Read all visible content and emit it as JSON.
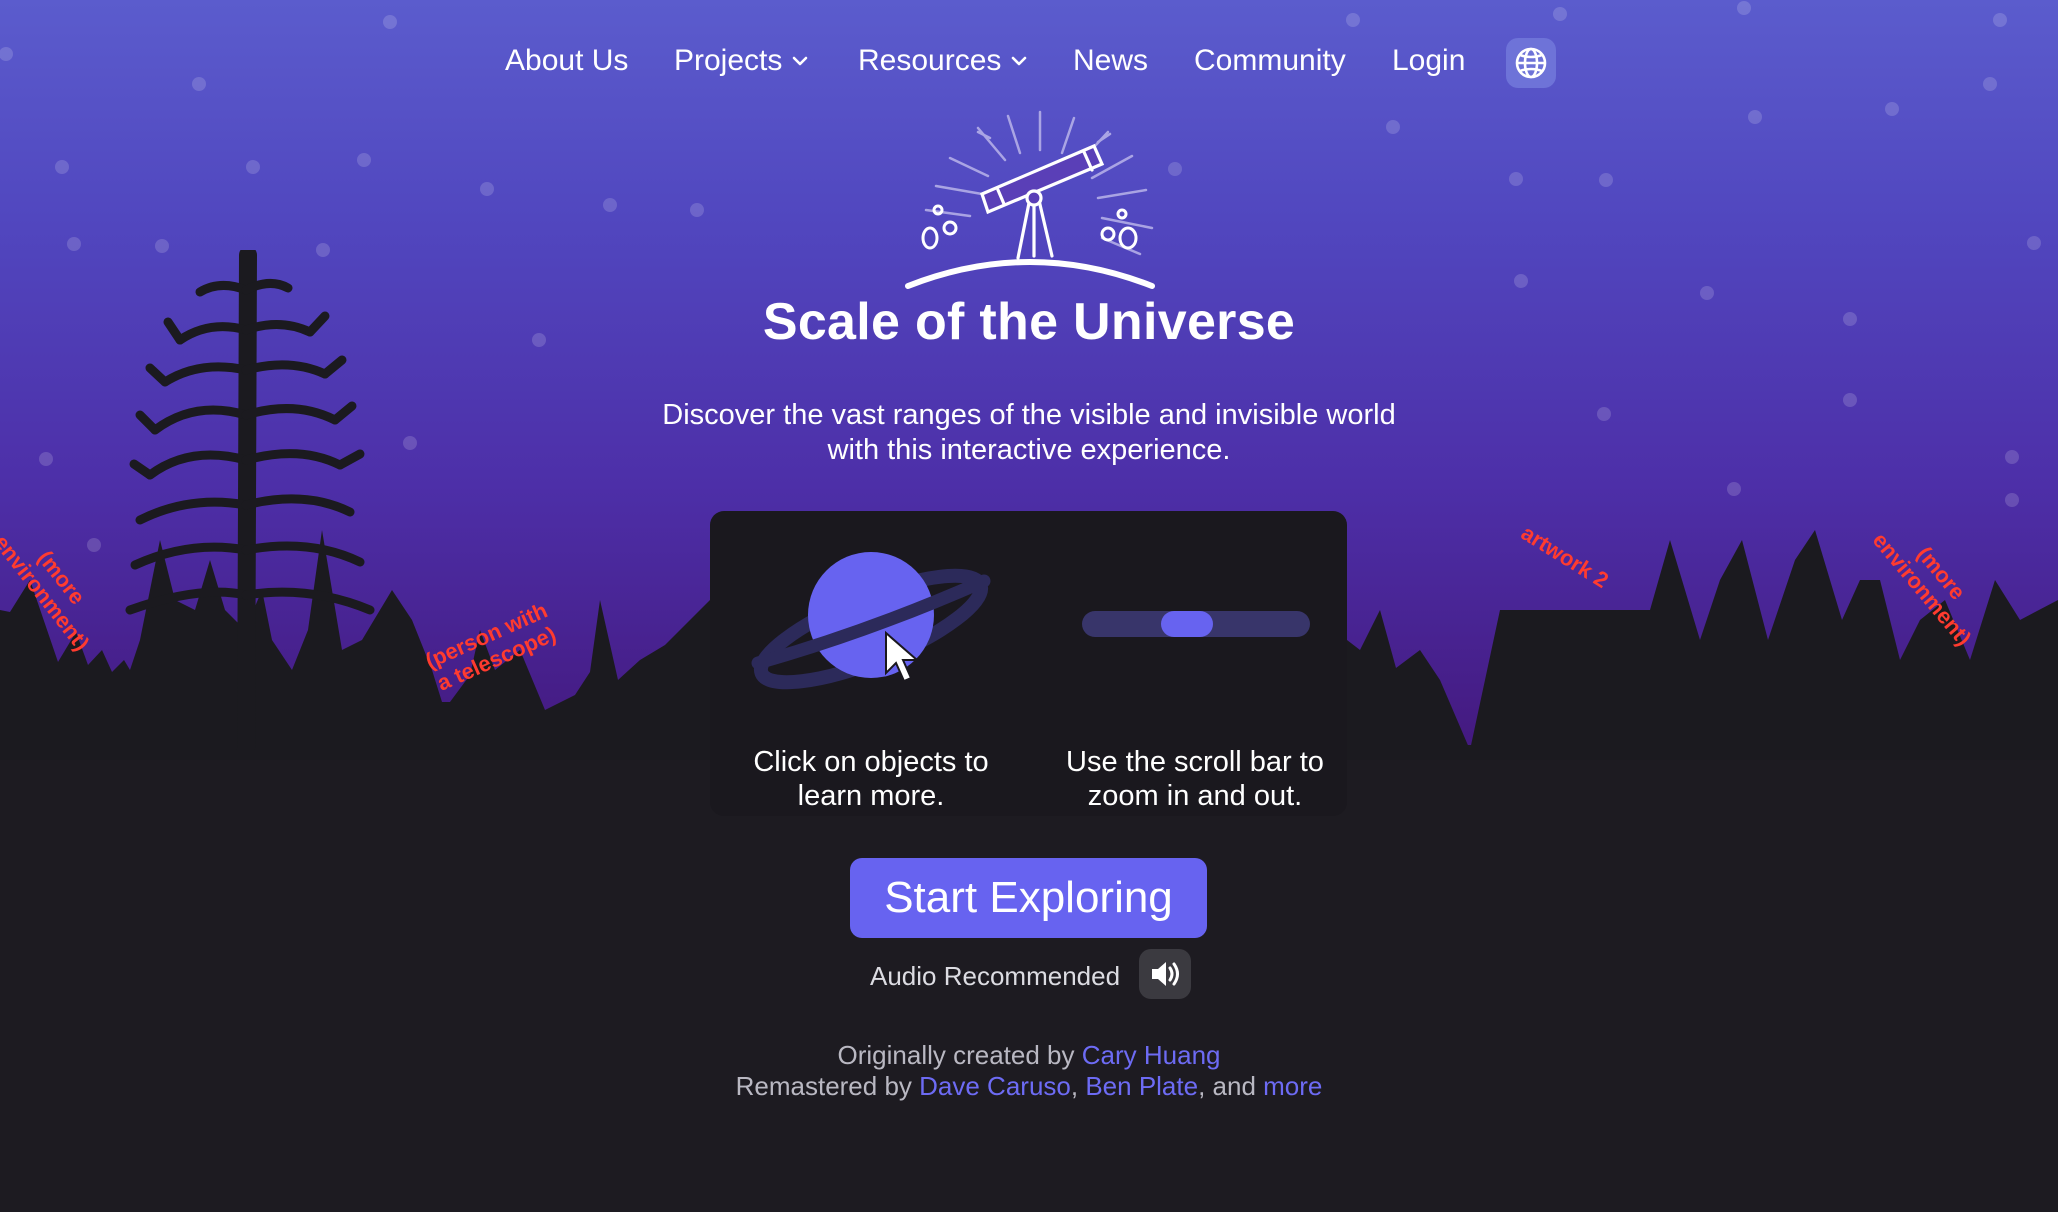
{
  "nav": {
    "items": [
      {
        "label": "About Us"
      },
      {
        "label": "Projects"
      },
      {
        "label": "Resources"
      },
      {
        "label": "News"
      },
      {
        "label": "Community"
      },
      {
        "label": "Login"
      }
    ],
    "language_icon": "globe-icon"
  },
  "hero": {
    "icon": "telescope-icon",
    "title": "Scale of the Universe",
    "subtitle_line1": "Discover the vast ranges of the visible and invisible world",
    "subtitle_line2": "with this interactive experience."
  },
  "instructions": {
    "click_line1": "Click on objects to",
    "click_line2": "learn more.",
    "scroll_line1": "Use the scroll bar to",
    "scroll_line2": "zoom in and out.",
    "slider_level": 0.45
  },
  "cta": {
    "label": "Start Exploring",
    "audio_label": "Audio Recommended",
    "audio_icon": "speaker-icon"
  },
  "credits": {
    "created_prefix": "Originally created by ",
    "creator": "Cary Huang",
    "remastered_prefix": "Remastered by ",
    "remaster1": "Dave Caruso",
    "sep1": ", ",
    "remaster2": "Ben Plate",
    "sep2": ", and ",
    "more": "more"
  },
  "placeholder_notes": {
    "left_env_line1": "(more",
    "left_env_line2": "environment)",
    "person_line1": "(person with",
    "person_line2": "a telescope)",
    "artwork": "artwork 2",
    "right_env_line1": "(more",
    "right_env_line2": "environment)"
  },
  "colors": {
    "accent": "#6763f0",
    "link": "#6d6bf4",
    "card": "#1a181e",
    "ground": "#1d1b21",
    "note": "#ff3b2f"
  }
}
